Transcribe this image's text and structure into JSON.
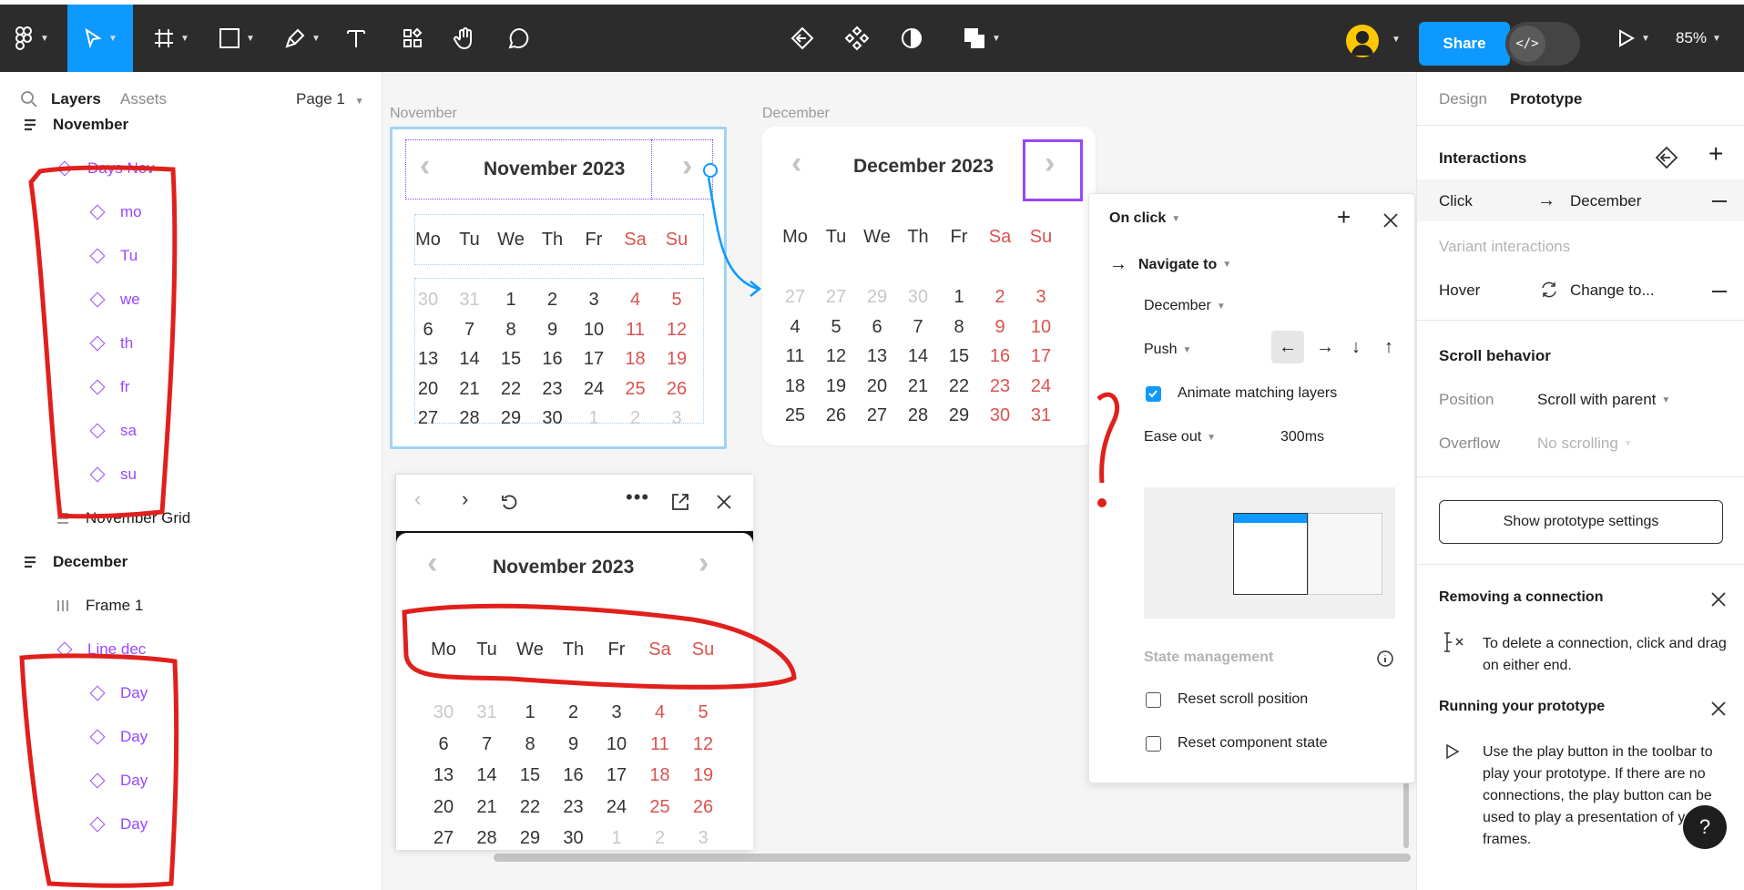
{
  "toolbar": {
    "share_label": "Share",
    "zoom_label": "85%",
    "dev_mode_glyph": "</>",
    "icons": [
      "figma-menu-icon",
      "move-tool-icon",
      "frame-tool-icon",
      "shape-tool-icon",
      "pen-tool-icon",
      "text-tool-icon",
      "resources-icon",
      "hand-tool-icon",
      "comment-tool-icon",
      "prototype-back-icon",
      "component-icon",
      "mask-icon",
      "boolean-icon",
      "play-icon"
    ]
  },
  "left_panel": {
    "tab_layers": "Layers",
    "tab_assets": "Assets",
    "page_label": "Page 1",
    "layers": [
      {
        "label": "November",
        "type": "frame"
      },
      {
        "label": "Days Nov",
        "type": "component"
      },
      {
        "label": "mo",
        "type": "component"
      },
      {
        "label": "Tu",
        "type": "component"
      },
      {
        "label": "we",
        "type": "component"
      },
      {
        "label": "th",
        "type": "component"
      },
      {
        "label": "fr",
        "type": "component"
      },
      {
        "label": "sa",
        "type": "component"
      },
      {
        "label": "su",
        "type": "component"
      },
      {
        "label": "November Grid",
        "type": "grid"
      },
      {
        "label": "December",
        "type": "frame"
      },
      {
        "label": "Frame 1",
        "type": "columns"
      },
      {
        "label": "Line dec",
        "type": "component"
      },
      {
        "label": "Day",
        "type": "component"
      },
      {
        "label": "Day",
        "type": "component"
      },
      {
        "label": "Day",
        "type": "component"
      },
      {
        "label": "Day",
        "type": "component"
      }
    ]
  },
  "canvas": {
    "nov_label": "November",
    "dec_label": "December",
    "nov_title": "November 2023",
    "dec_title": "December 2023",
    "weekdays": [
      "Mo",
      "Tu",
      "We",
      "Th",
      "Fr",
      "Sa",
      "Su"
    ],
    "nov_weeks": [
      [
        "30",
        "31",
        "1",
        "2",
        "3",
        "4",
        "5"
      ],
      [
        "6",
        "7",
        "8",
        "9",
        "10",
        "11",
        "12"
      ],
      [
        "13",
        "14",
        "15",
        "16",
        "17",
        "18",
        "19"
      ],
      [
        "20",
        "21",
        "22",
        "23",
        "24",
        "25",
        "26"
      ],
      [
        "27",
        "28",
        "29",
        "30",
        "1",
        "2",
        "3"
      ]
    ],
    "dec_weeks": [
      [
        "27",
        "27",
        "29",
        "30",
        "1",
        "2",
        "3"
      ],
      [
        "4",
        "5",
        "6",
        "7",
        "8",
        "9",
        "10"
      ],
      [
        "11",
        "12",
        "13",
        "14",
        "15",
        "16",
        "17"
      ],
      [
        "18",
        "19",
        "20",
        "21",
        "22",
        "23",
        "24"
      ],
      [
        "25",
        "26",
        "27",
        "28",
        "29",
        "30",
        "31"
      ]
    ],
    "annotation_mark": "?"
  },
  "popover": {
    "trigger": "On click",
    "action": "Navigate to",
    "destination": "December",
    "animation": "Push",
    "animate_matching": "Animate matching layers",
    "easing": "Ease out",
    "duration": "300ms",
    "state_management": "State management",
    "reset_scroll": "Reset scroll position",
    "reset_component": "Reset component state"
  },
  "right_panel": {
    "tab_design": "Design",
    "tab_prototype": "Prototype",
    "interactions_title": "Interactions",
    "click_label": "Click",
    "click_target": "December",
    "variant_interactions": "Variant interactions",
    "hover_label": "Hover",
    "hover_target": "Change to...",
    "scroll_title": "Scroll behavior",
    "position_label": "Position",
    "position_value": "Scroll with parent",
    "overflow_label": "Overflow",
    "overflow_value": "No scrolling",
    "show_settings": "Show prototype settings",
    "removing_title": "Removing a connection",
    "removing_text": "To delete a connection, click and drag on either end.",
    "running_title": "Running your prototype",
    "running_text": "Use the play button in the toolbar to play your prototype. If there are no connections, the play button can be used to play a presentation of your frames.",
    "help_glyph": "?"
  },
  "colors": {
    "accent_blue": "#0d99ff",
    "component_purple": "#9747ff",
    "weekend_red": "#d9534f",
    "annotation_red": "#e0201c"
  }
}
